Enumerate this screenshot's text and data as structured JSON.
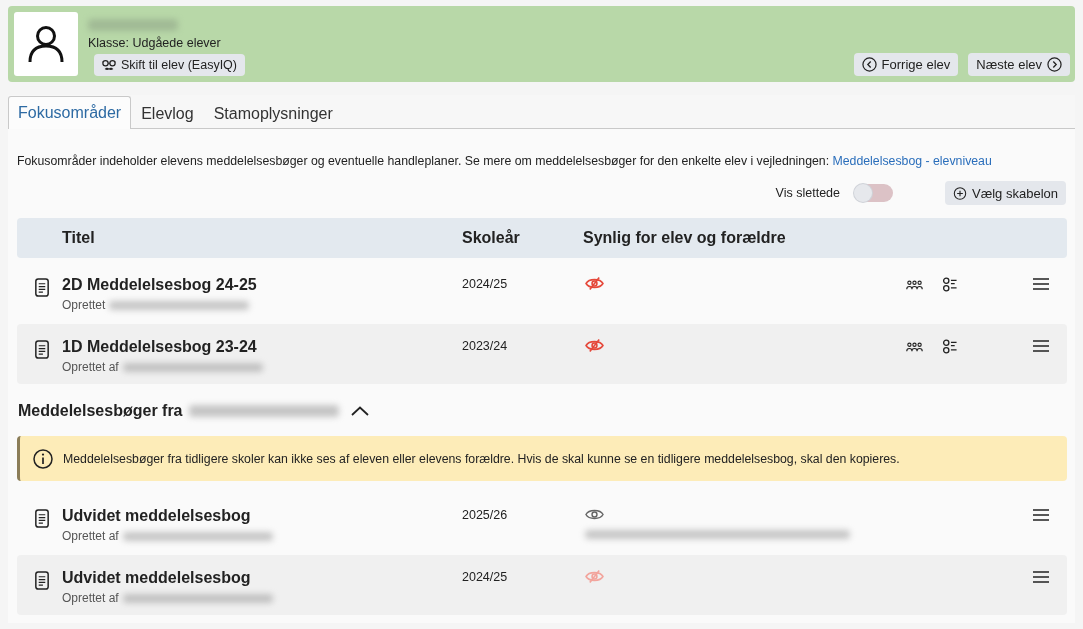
{
  "student": {
    "class_label": "Klasse: Udgåede elever",
    "switch_button": "Skift til elev (EasyIQ)"
  },
  "nav_buttons": [
    {
      "kind": "prev",
      "label": "Forrige elev"
    },
    {
      "kind": "next",
      "label": "Næste elev"
    }
  ],
  "tabs": [
    {
      "label": "Fokusområder",
      "selected": true
    },
    {
      "label": "Elevlog",
      "selected": false
    },
    {
      "label": "Stamoplysninger",
      "selected": false
    }
  ],
  "intro": {
    "text": "Fokusområder indeholder elevens meddelelsesbøger og eventuelle handleplaner. Se mere om meddelelsesbøger for den enkelte elev i vejledningen:",
    "link": "Meddelelsesbog - elevniveau"
  },
  "show_deleted": {
    "label": "Vis slettede",
    "on": false
  },
  "template_button": "Vælg skabelon",
  "table": {
    "columns": [
      "Titel",
      "Skoleår",
      "Synlig for elev og forældre"
    ],
    "rows": [
      {
        "kind": "hidden",
        "title": "2D Meddelelsesbog 24-25",
        "created": "Oprettet",
        "school_year": "2024/25",
        "visibility_note": false,
        "extra_actions": true
      },
      {
        "kind": "hidden",
        "title": "1D Meddelelsesbog 23-24",
        "created": "Oprettet af",
        "school_year": "2023/24",
        "visibility_note": false,
        "extra_actions": true
      }
    ]
  },
  "previous_school": {
    "heading": "Meddelelsesbøger fra",
    "expanded": true,
    "notice": "Meddelelsesbøger fra tidligere skoler kan ikke ses af eleven eller elevens forældre. Hvis de skal kunne se en tidligere meddelelsesbog, skal den kopieres.",
    "rows": [
      {
        "kind": "visible",
        "title": "Udvidet meddelelsesbog",
        "created": "Oprettet af",
        "school_year": "2025/26",
        "visibility_note": true,
        "extra_actions": false
      },
      {
        "kind": "locked",
        "title": "Udvidet meddelelsesbog",
        "created": "Oprettet af",
        "school_year": "2024/25",
        "visibility_note": false,
        "extra_actions": false
      }
    ]
  }
}
